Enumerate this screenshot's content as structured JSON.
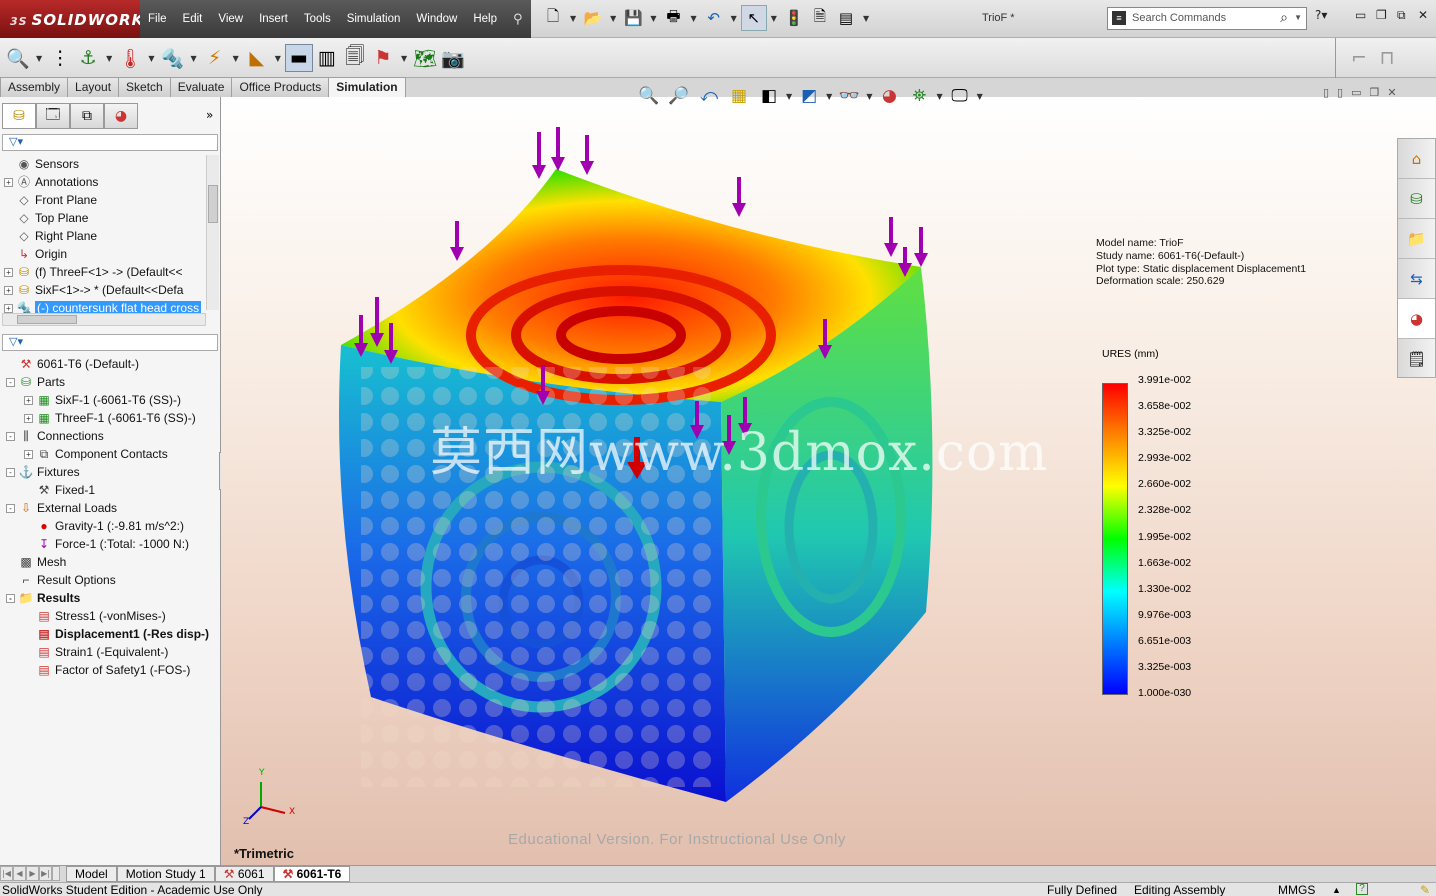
{
  "app": {
    "brand": "SOLIDWORKS",
    "document_title": "TrioF *"
  },
  "menu": [
    "File",
    "Edit",
    "View",
    "Insert",
    "Tools",
    "Simulation",
    "Window",
    "Help"
  ],
  "search": {
    "placeholder": "Search Commands"
  },
  "command_tabs": [
    {
      "label": "Assembly",
      "active": false
    },
    {
      "label": "Layout",
      "active": false
    },
    {
      "label": "Sketch",
      "active": false
    },
    {
      "label": "Evaluate",
      "active": false
    },
    {
      "label": "Office Products",
      "active": false
    },
    {
      "label": "Simulation",
      "active": true
    }
  ],
  "feature_tree": [
    {
      "label": "Sensors",
      "icon": "sensor-icon",
      "expand": false
    },
    {
      "label": "Annotations",
      "icon": "annotation-icon",
      "expand": true
    },
    {
      "label": "Front Plane",
      "icon": "plane-icon",
      "expand": false
    },
    {
      "label": "Top Plane",
      "icon": "plane-icon",
      "expand": false
    },
    {
      "label": "Right Plane",
      "icon": "plane-icon",
      "expand": false
    },
    {
      "label": "Origin",
      "icon": "origin-icon",
      "expand": false
    },
    {
      "label": "(f) ThreeF<1> -> (Default<<",
      "icon": "part-icon",
      "expand": true
    },
    {
      "label": "SixF<1>-> * (Default<<Defa",
      "icon": "part-icon",
      "expand": true
    },
    {
      "label": "(-) countersunk flat head cross",
      "icon": "screw-icon",
      "expand": true,
      "selected": true
    }
  ],
  "sim_tree": [
    {
      "label": "6061-T6 (-Default-)",
      "icon": "study-icon",
      "level": 0,
      "expand": null
    },
    {
      "label": "Parts",
      "icon": "parts-folder-icon",
      "level": 0,
      "expand": "-"
    },
    {
      "label": "SixF-1 (-6061-T6 (SS)-)",
      "icon": "mesh-part-icon",
      "level": 1,
      "expand": "+"
    },
    {
      "label": "ThreeF-1 (-6061-T6 (SS)-)",
      "icon": "mesh-part-icon",
      "level": 1,
      "expand": "+"
    },
    {
      "label": "Connections",
      "icon": "connections-icon",
      "level": 0,
      "expand": "-"
    },
    {
      "label": "Component Contacts",
      "icon": "contact-icon",
      "level": 1,
      "expand": "+"
    },
    {
      "label": "Fixtures",
      "icon": "fixtures-icon",
      "level": 0,
      "expand": "-"
    },
    {
      "label": "Fixed-1",
      "icon": "fixed-icon",
      "level": 1,
      "expand": null
    },
    {
      "label": "External Loads",
      "icon": "loads-icon",
      "level": 0,
      "expand": "-"
    },
    {
      "label": "Gravity-1 (:-9.81 m/s^2:)",
      "icon": "gravity-icon",
      "level": 1,
      "expand": null
    },
    {
      "label": "Force-1 (:Total: -1000 N:)",
      "icon": "force-icon",
      "level": 1,
      "expand": null
    },
    {
      "label": "Mesh",
      "icon": "mesh-icon",
      "level": 0,
      "expand": null
    },
    {
      "label": "Result Options",
      "icon": "result-options-icon",
      "level": 0,
      "expand": null
    },
    {
      "label": "Results",
      "icon": "results-folder-icon",
      "level": 0,
      "expand": "-",
      "bold": true
    },
    {
      "label": "Stress1 (-vonMises-)",
      "icon": "plot-icon",
      "level": 1,
      "expand": null
    },
    {
      "label": "Displacement1 (-Res disp-)",
      "icon": "plot-icon",
      "level": 1,
      "expand": null,
      "bold": true
    },
    {
      "label": "Strain1 (-Equivalent-)",
      "icon": "plot-icon",
      "level": 1,
      "expand": null
    },
    {
      "label": "Factor of Safety1 (-FOS-)",
      "icon": "plot-icon",
      "level": 1,
      "expand": null
    }
  ],
  "plot_info": {
    "model_name": "Model name: TrioF",
    "study_name": "Study name: 6061-T6(-Default-)",
    "plot_type": "Plot type: Static displacement Displacement1",
    "deformation_scale": "Deformation scale: 250.629"
  },
  "legend": {
    "title": "URES (mm)",
    "values": [
      "3.991e-002",
      "3.658e-002",
      "3.325e-002",
      "2.993e-002",
      "2.660e-002",
      "2.328e-002",
      "1.995e-002",
      "1.663e-002",
      "1.330e-002",
      "9.976e-003",
      "6.651e-003",
      "3.325e-003",
      "1.000e-030"
    ],
    "colors": [
      "#ff0000",
      "#ff8000",
      "#ffff00",
      "#00ff00",
      "#00ffff",
      "#0080ff",
      "#0000ff"
    ]
  },
  "viewport": {
    "view_name": "*Trimetric",
    "educational": "Educational Version. For Instructional Use Only",
    "watermark": "莫西网www.3dmox.com",
    "triad": {
      "x": "X",
      "y": "Y",
      "z": "Z"
    }
  },
  "bottom_tabs": [
    {
      "label": "Model",
      "active": false
    },
    {
      "label": "Motion Study 1",
      "active": false
    },
    {
      "label": "6061",
      "active": false
    },
    {
      "label": "6061-T6",
      "active": true
    }
  ],
  "status": {
    "edition": "SolidWorks Student Edition - Academic Use Only",
    "defined": "Fully Defined",
    "mode": "Editing Assembly",
    "units": "MMGS",
    "help": "?"
  }
}
